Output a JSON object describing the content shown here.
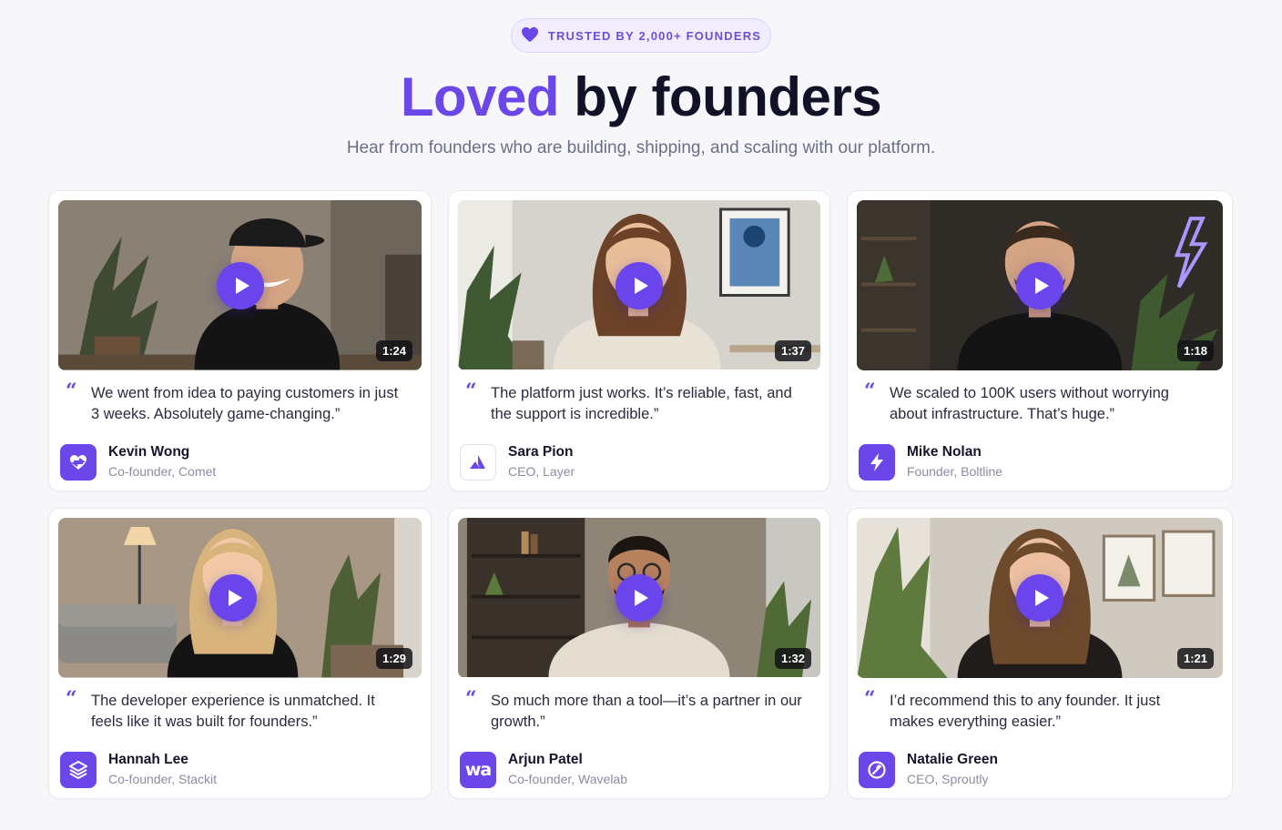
{
  "badge": {
    "text": "TRUSTED BY 2,000+ FOUNDERS",
    "icon": "heart-icon"
  },
  "headline": {
    "accent": "Loved",
    "rest": "by founders"
  },
  "subtitle": "Hear from founders who are building, shipping, and scaling with our platform.",
  "colors": {
    "accent": "#6b47ea",
    "background": "#f7f7fb"
  },
  "testimonials": [
    {
      "duration": "1:24",
      "quote": "We went from idea to paying customers in just 3 weeks. Absolutely game-changing.”",
      "name": "Kevin Wong",
      "role": "Co-founder, Comet",
      "logo_icon": "heart-logo-icon"
    },
    {
      "duration": "1:37",
      "quote": "The platform just works. It’s reliable, fast, and the support is incredible.”",
      "name": "Sara Pion",
      "role": "CEO, Layer",
      "logo_icon": "triangle-logo-icon"
    },
    {
      "duration": "1:18",
      "quote": "We scaled to 100K users without worrying about infrastructure. That’s huge.”",
      "name": "Mike Nolan",
      "role": "Founder, Boltline",
      "logo_icon": "bolt-logo-icon"
    },
    {
      "duration": "1:29",
      "quote": "The developer experience is unmatched. It feels like it was built for founders.”",
      "name": "Hannah Lee",
      "role": "Co-founder, Stackit",
      "logo_icon": "stack-logo-icon"
    },
    {
      "duration": "1:32",
      "quote": "So much more than a tool—it’s a partner in our growth.”",
      "name": "Arjun Patel",
      "role": "Co-founder, Wavelab",
      "logo_icon": "wa-logo-icon",
      "logo_text": "wa"
    },
    {
      "duration": "1:21",
      "quote": "I’d recommend this to any founder. It just makes everything easier.”",
      "name": "Natalie Green",
      "role": "CEO, Sproutly",
      "logo_icon": "sprout-logo-icon"
    }
  ]
}
